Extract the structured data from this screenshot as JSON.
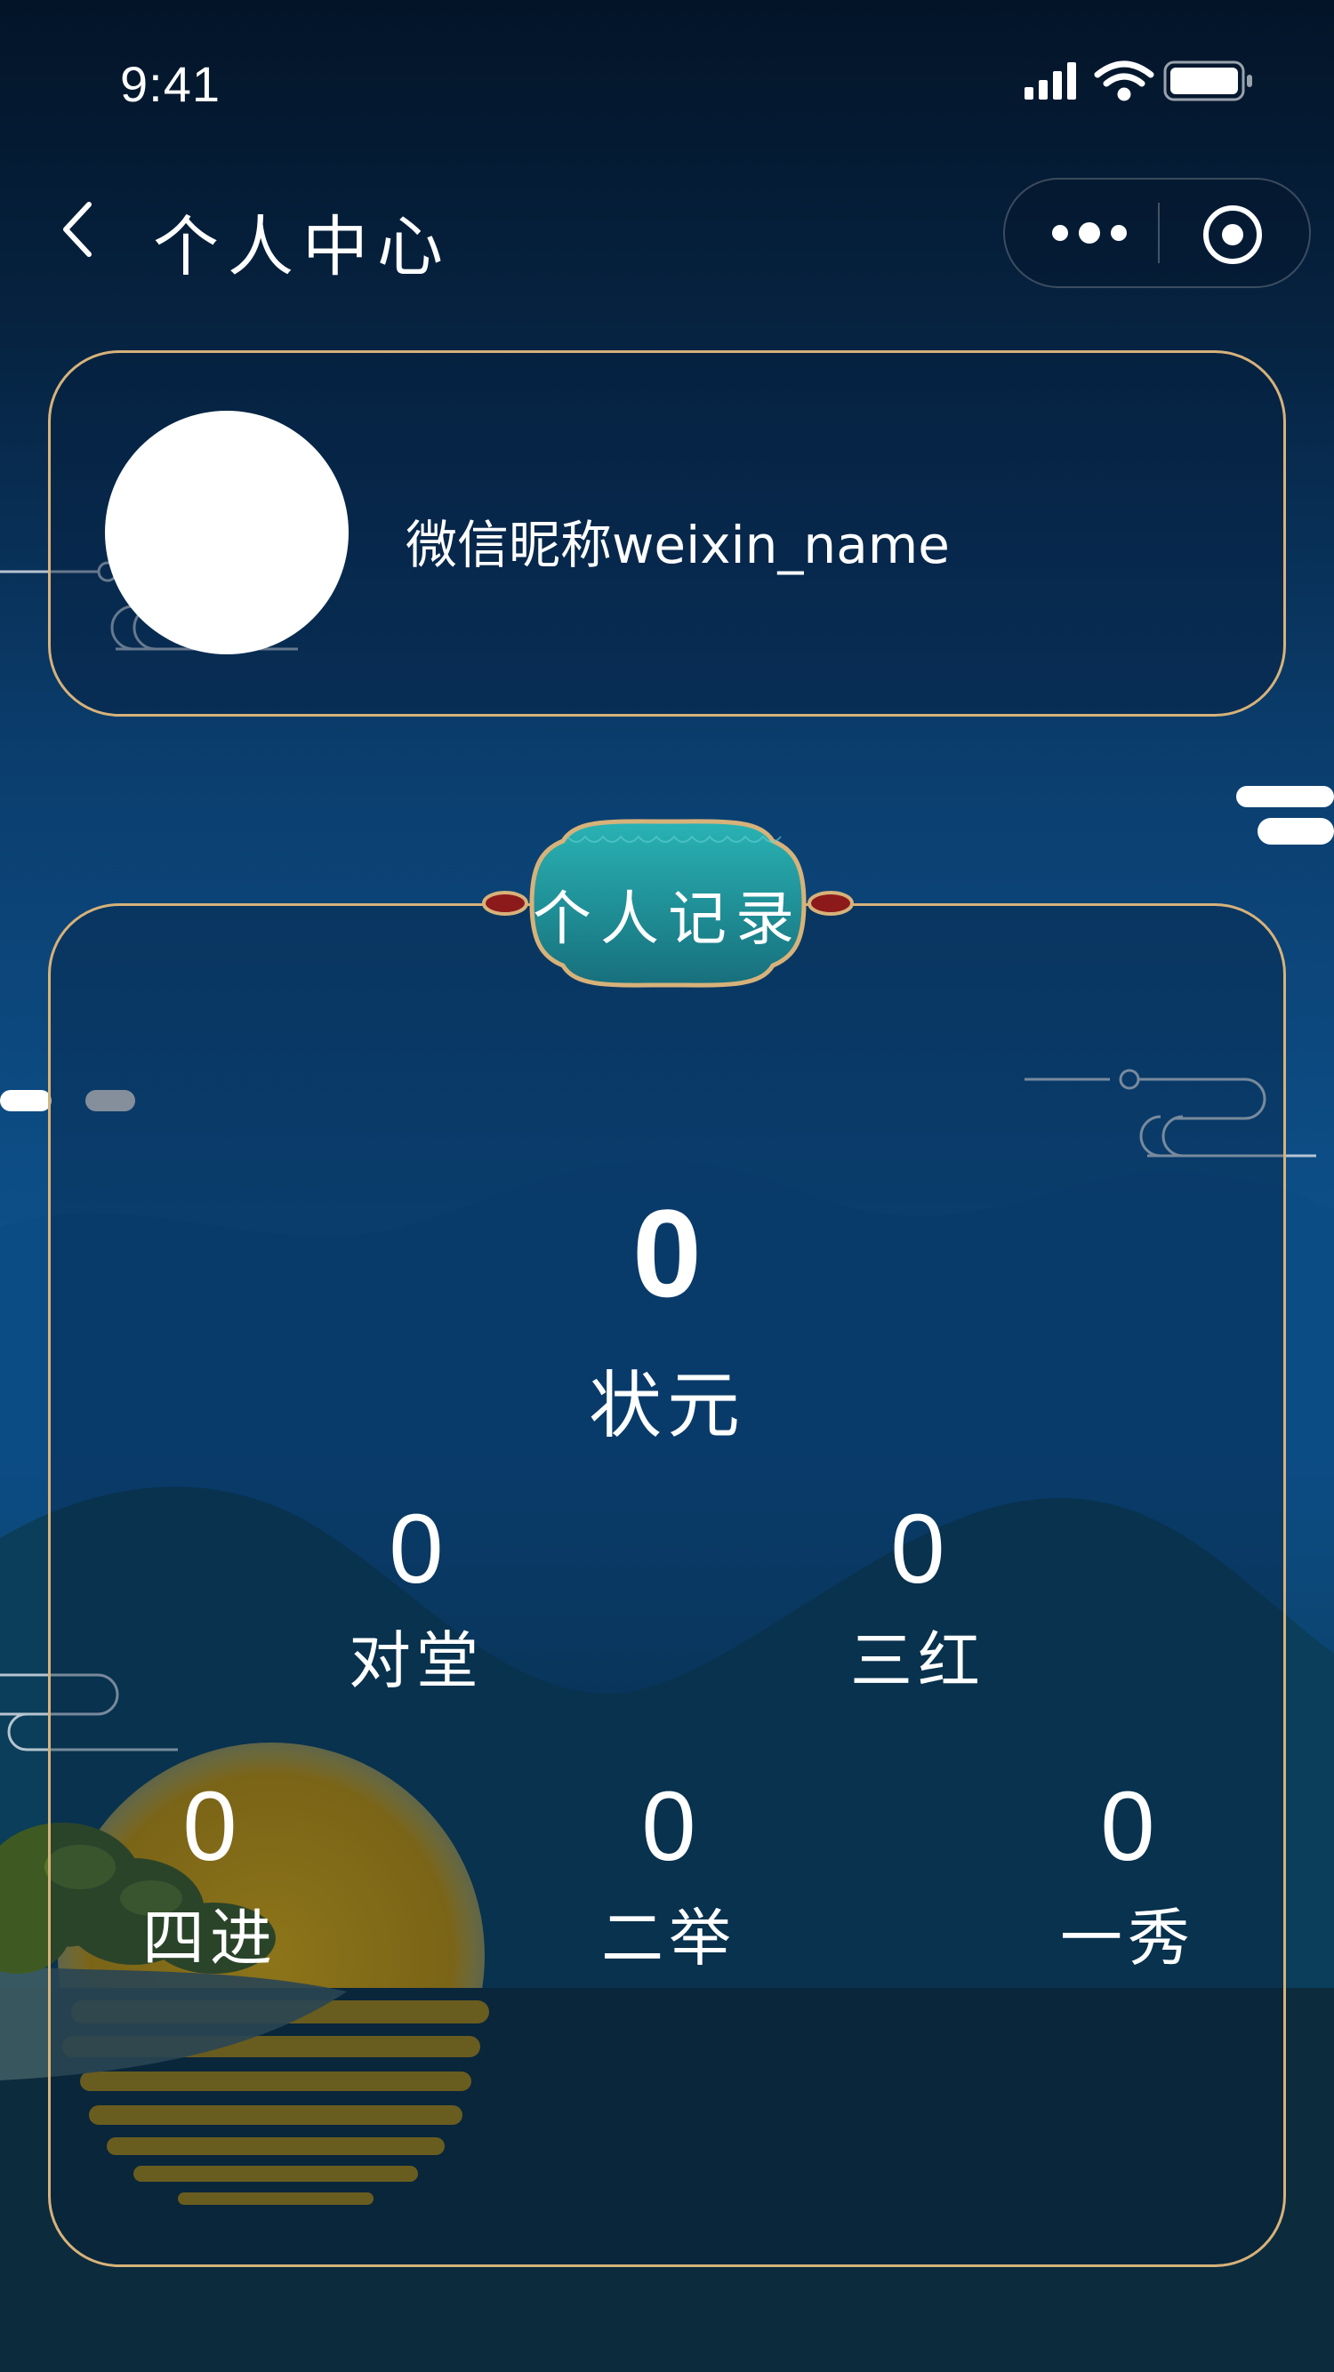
{
  "status_bar": {
    "time": "9:41"
  },
  "nav": {
    "title": "个人中心"
  },
  "profile": {
    "nickname": "微信昵称weixin_name"
  },
  "records": {
    "title": "个人记录",
    "top": {
      "value": "0",
      "label": "状元"
    },
    "row2": [
      {
        "value": "0",
        "label": "对堂"
      },
      {
        "value": "0",
        "label": "三红"
      }
    ],
    "row3": [
      {
        "value": "0",
        "label": "四进"
      },
      {
        "value": "0",
        "label": "二举"
      },
      {
        "value": "0",
        "label": "一秀"
      }
    ]
  },
  "colors": {
    "card_border": "#d7b27a",
    "badge_teal": "#1e9aa0",
    "moon": "#c9980a"
  }
}
